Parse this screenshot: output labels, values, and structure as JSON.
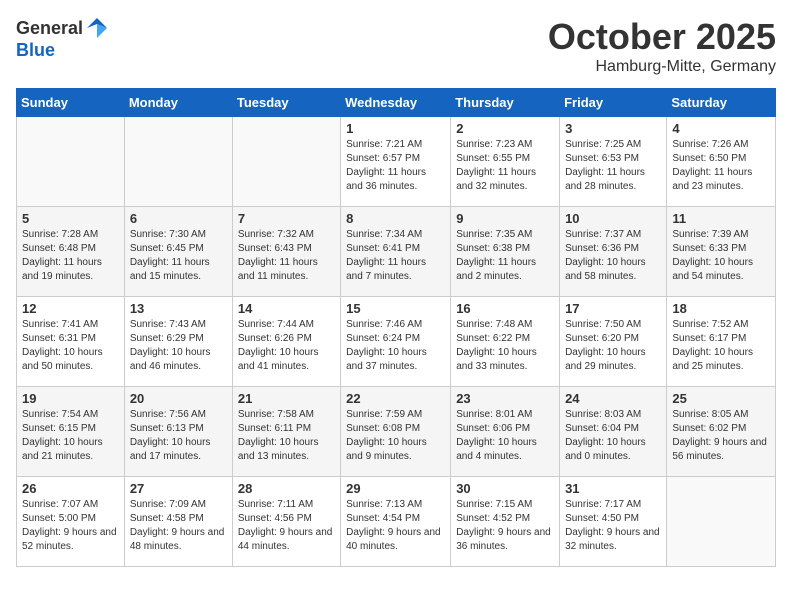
{
  "header": {
    "logo_general": "General",
    "logo_blue": "Blue",
    "month": "October 2025",
    "location": "Hamburg-Mitte, Germany"
  },
  "days_of_week": [
    "Sunday",
    "Monday",
    "Tuesday",
    "Wednesday",
    "Thursday",
    "Friday",
    "Saturday"
  ],
  "weeks": [
    [
      {
        "day": "",
        "info": ""
      },
      {
        "day": "",
        "info": ""
      },
      {
        "day": "",
        "info": ""
      },
      {
        "day": "1",
        "info": "Sunrise: 7:21 AM\nSunset: 6:57 PM\nDaylight: 11 hours and 36 minutes."
      },
      {
        "day": "2",
        "info": "Sunrise: 7:23 AM\nSunset: 6:55 PM\nDaylight: 11 hours and 32 minutes."
      },
      {
        "day": "3",
        "info": "Sunrise: 7:25 AM\nSunset: 6:53 PM\nDaylight: 11 hours and 28 minutes."
      },
      {
        "day": "4",
        "info": "Sunrise: 7:26 AM\nSunset: 6:50 PM\nDaylight: 11 hours and 23 minutes."
      }
    ],
    [
      {
        "day": "5",
        "info": "Sunrise: 7:28 AM\nSunset: 6:48 PM\nDaylight: 11 hours and 19 minutes."
      },
      {
        "day": "6",
        "info": "Sunrise: 7:30 AM\nSunset: 6:45 PM\nDaylight: 11 hours and 15 minutes."
      },
      {
        "day": "7",
        "info": "Sunrise: 7:32 AM\nSunset: 6:43 PM\nDaylight: 11 hours and 11 minutes."
      },
      {
        "day": "8",
        "info": "Sunrise: 7:34 AM\nSunset: 6:41 PM\nDaylight: 11 hours and 7 minutes."
      },
      {
        "day": "9",
        "info": "Sunrise: 7:35 AM\nSunset: 6:38 PM\nDaylight: 11 hours and 2 minutes."
      },
      {
        "day": "10",
        "info": "Sunrise: 7:37 AM\nSunset: 6:36 PM\nDaylight: 10 hours and 58 minutes."
      },
      {
        "day": "11",
        "info": "Sunrise: 7:39 AM\nSunset: 6:33 PM\nDaylight: 10 hours and 54 minutes."
      }
    ],
    [
      {
        "day": "12",
        "info": "Sunrise: 7:41 AM\nSunset: 6:31 PM\nDaylight: 10 hours and 50 minutes."
      },
      {
        "day": "13",
        "info": "Sunrise: 7:43 AM\nSunset: 6:29 PM\nDaylight: 10 hours and 46 minutes."
      },
      {
        "day": "14",
        "info": "Sunrise: 7:44 AM\nSunset: 6:26 PM\nDaylight: 10 hours and 41 minutes."
      },
      {
        "day": "15",
        "info": "Sunrise: 7:46 AM\nSunset: 6:24 PM\nDaylight: 10 hours and 37 minutes."
      },
      {
        "day": "16",
        "info": "Sunrise: 7:48 AM\nSunset: 6:22 PM\nDaylight: 10 hours and 33 minutes."
      },
      {
        "day": "17",
        "info": "Sunrise: 7:50 AM\nSunset: 6:20 PM\nDaylight: 10 hours and 29 minutes."
      },
      {
        "day": "18",
        "info": "Sunrise: 7:52 AM\nSunset: 6:17 PM\nDaylight: 10 hours and 25 minutes."
      }
    ],
    [
      {
        "day": "19",
        "info": "Sunrise: 7:54 AM\nSunset: 6:15 PM\nDaylight: 10 hours and 21 minutes."
      },
      {
        "day": "20",
        "info": "Sunrise: 7:56 AM\nSunset: 6:13 PM\nDaylight: 10 hours and 17 minutes."
      },
      {
        "day": "21",
        "info": "Sunrise: 7:58 AM\nSunset: 6:11 PM\nDaylight: 10 hours and 13 minutes."
      },
      {
        "day": "22",
        "info": "Sunrise: 7:59 AM\nSunset: 6:08 PM\nDaylight: 10 hours and 9 minutes."
      },
      {
        "day": "23",
        "info": "Sunrise: 8:01 AM\nSunset: 6:06 PM\nDaylight: 10 hours and 4 minutes."
      },
      {
        "day": "24",
        "info": "Sunrise: 8:03 AM\nSunset: 6:04 PM\nDaylight: 10 hours and 0 minutes."
      },
      {
        "day": "25",
        "info": "Sunrise: 8:05 AM\nSunset: 6:02 PM\nDaylight: 9 hours and 56 minutes."
      }
    ],
    [
      {
        "day": "26",
        "info": "Sunrise: 7:07 AM\nSunset: 5:00 PM\nDaylight: 9 hours and 52 minutes."
      },
      {
        "day": "27",
        "info": "Sunrise: 7:09 AM\nSunset: 4:58 PM\nDaylight: 9 hours and 48 minutes."
      },
      {
        "day": "28",
        "info": "Sunrise: 7:11 AM\nSunset: 4:56 PM\nDaylight: 9 hours and 44 minutes."
      },
      {
        "day": "29",
        "info": "Sunrise: 7:13 AM\nSunset: 4:54 PM\nDaylight: 9 hours and 40 minutes."
      },
      {
        "day": "30",
        "info": "Sunrise: 7:15 AM\nSunset: 4:52 PM\nDaylight: 9 hours and 36 minutes."
      },
      {
        "day": "31",
        "info": "Sunrise: 7:17 AM\nSunset: 4:50 PM\nDaylight: 9 hours and 32 minutes."
      },
      {
        "day": "",
        "info": ""
      }
    ]
  ]
}
